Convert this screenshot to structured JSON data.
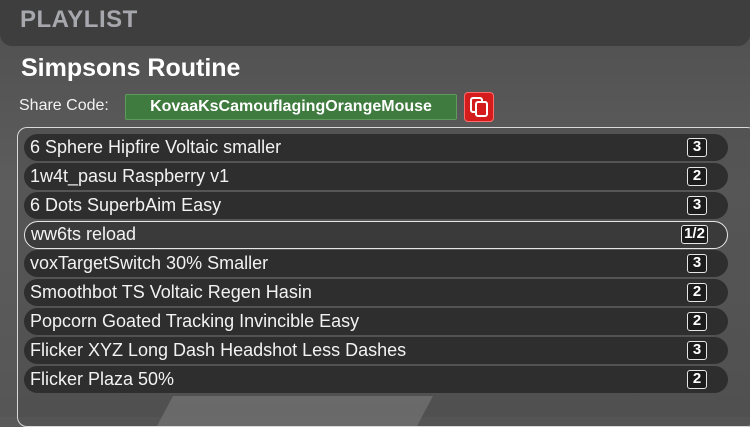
{
  "header": {
    "title": "PLAYLIST"
  },
  "playlist": {
    "name": "Simpsons Routine",
    "share_label": "Share Code:",
    "share_code": "KovaaKsCamouflagingOrangeMouse",
    "copy_icon": "copy-icon"
  },
  "colors": {
    "share_code_bg": "#3f7a3e",
    "copy_button_bg": "#d51c1c",
    "header_bg": "#3e3e3e"
  },
  "scenarios": [
    {
      "name": "6 Sphere Hipfire Voltaic smaller",
      "count": "3"
    },
    {
      "name": "1w4t_pasu Raspberry v1",
      "count": "2"
    },
    {
      "name": "6 Dots SuperbAim Easy",
      "count": "3"
    },
    {
      "name": "ww6ts reload",
      "count": "1/2",
      "highlighted": true
    },
    {
      "name": "voxTargetSwitch 30% Smaller",
      "count": "3"
    },
    {
      "name": "Smoothbot TS Voltaic Regen Hasin",
      "count": "2"
    },
    {
      "name": "Popcorn Goated Tracking Invincible Easy",
      "count": "2"
    },
    {
      "name": "Flicker XYZ Long Dash Headshot Less Dashes",
      "count": "3"
    },
    {
      "name": "Flicker Plaza 50%",
      "count": "2"
    }
  ]
}
